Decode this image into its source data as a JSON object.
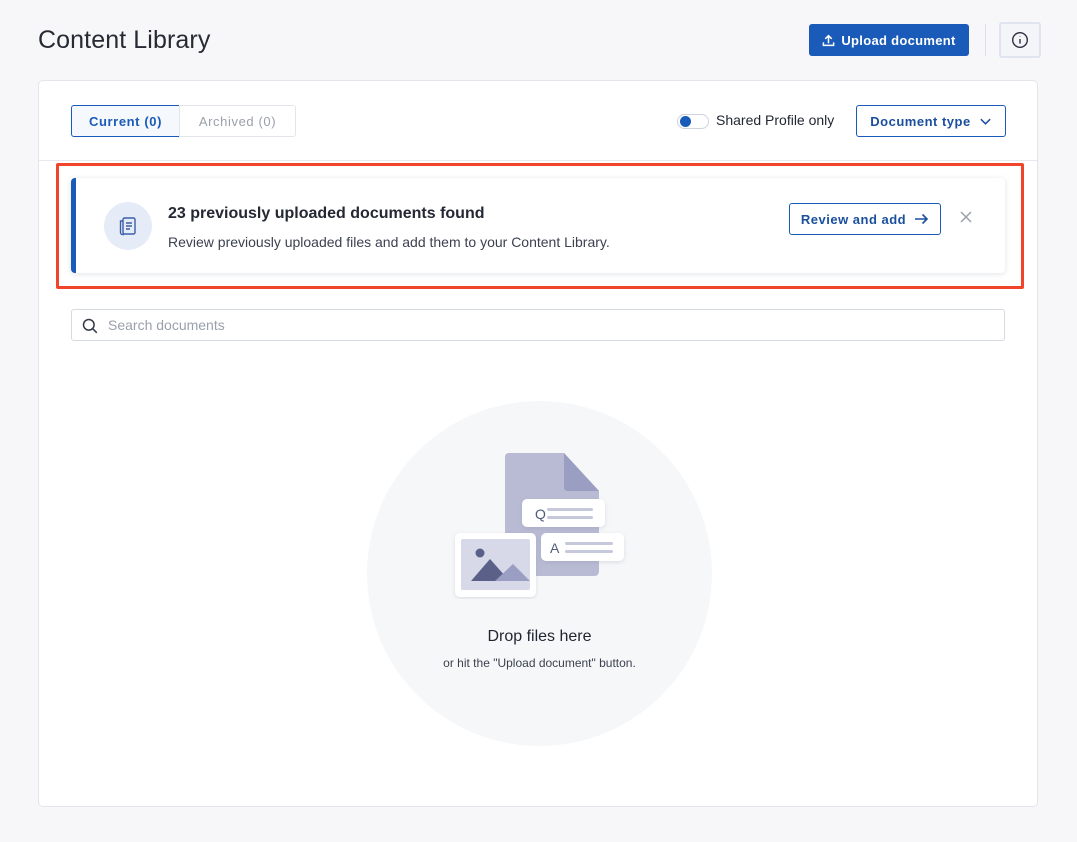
{
  "header": {
    "title": "Content Library",
    "upload_label": "Upload document"
  },
  "tabs": [
    {
      "label": "Current (0)",
      "active": true
    },
    {
      "label": "Archived (0)",
      "active": false
    }
  ],
  "filters": {
    "shared_profile_label": "Shared Profile only",
    "shared_profile_on": true,
    "document_type_label": "Document type"
  },
  "banner": {
    "title": "23 previously uploaded documents found",
    "text": "Review previously uploaded files and add them to your Content Library.",
    "review_label": "Review and add"
  },
  "search": {
    "placeholder": "Search documents"
  },
  "empty_state": {
    "title": "Drop files here",
    "subtitle": "or hit the \"Upload document\" button.",
    "q_letter": "Q",
    "a_letter": "A"
  },
  "colors": {
    "primary": "#1a5ab8",
    "highlight": "#f0452b",
    "background": "#f7f7f9"
  },
  "icons": {
    "upload": "upload-icon",
    "info": "info-icon",
    "chevron": "chevron-down-icon",
    "banner": "document-list-icon",
    "arrow": "arrow-right-icon",
    "close": "close-icon",
    "search": "search-icon"
  }
}
